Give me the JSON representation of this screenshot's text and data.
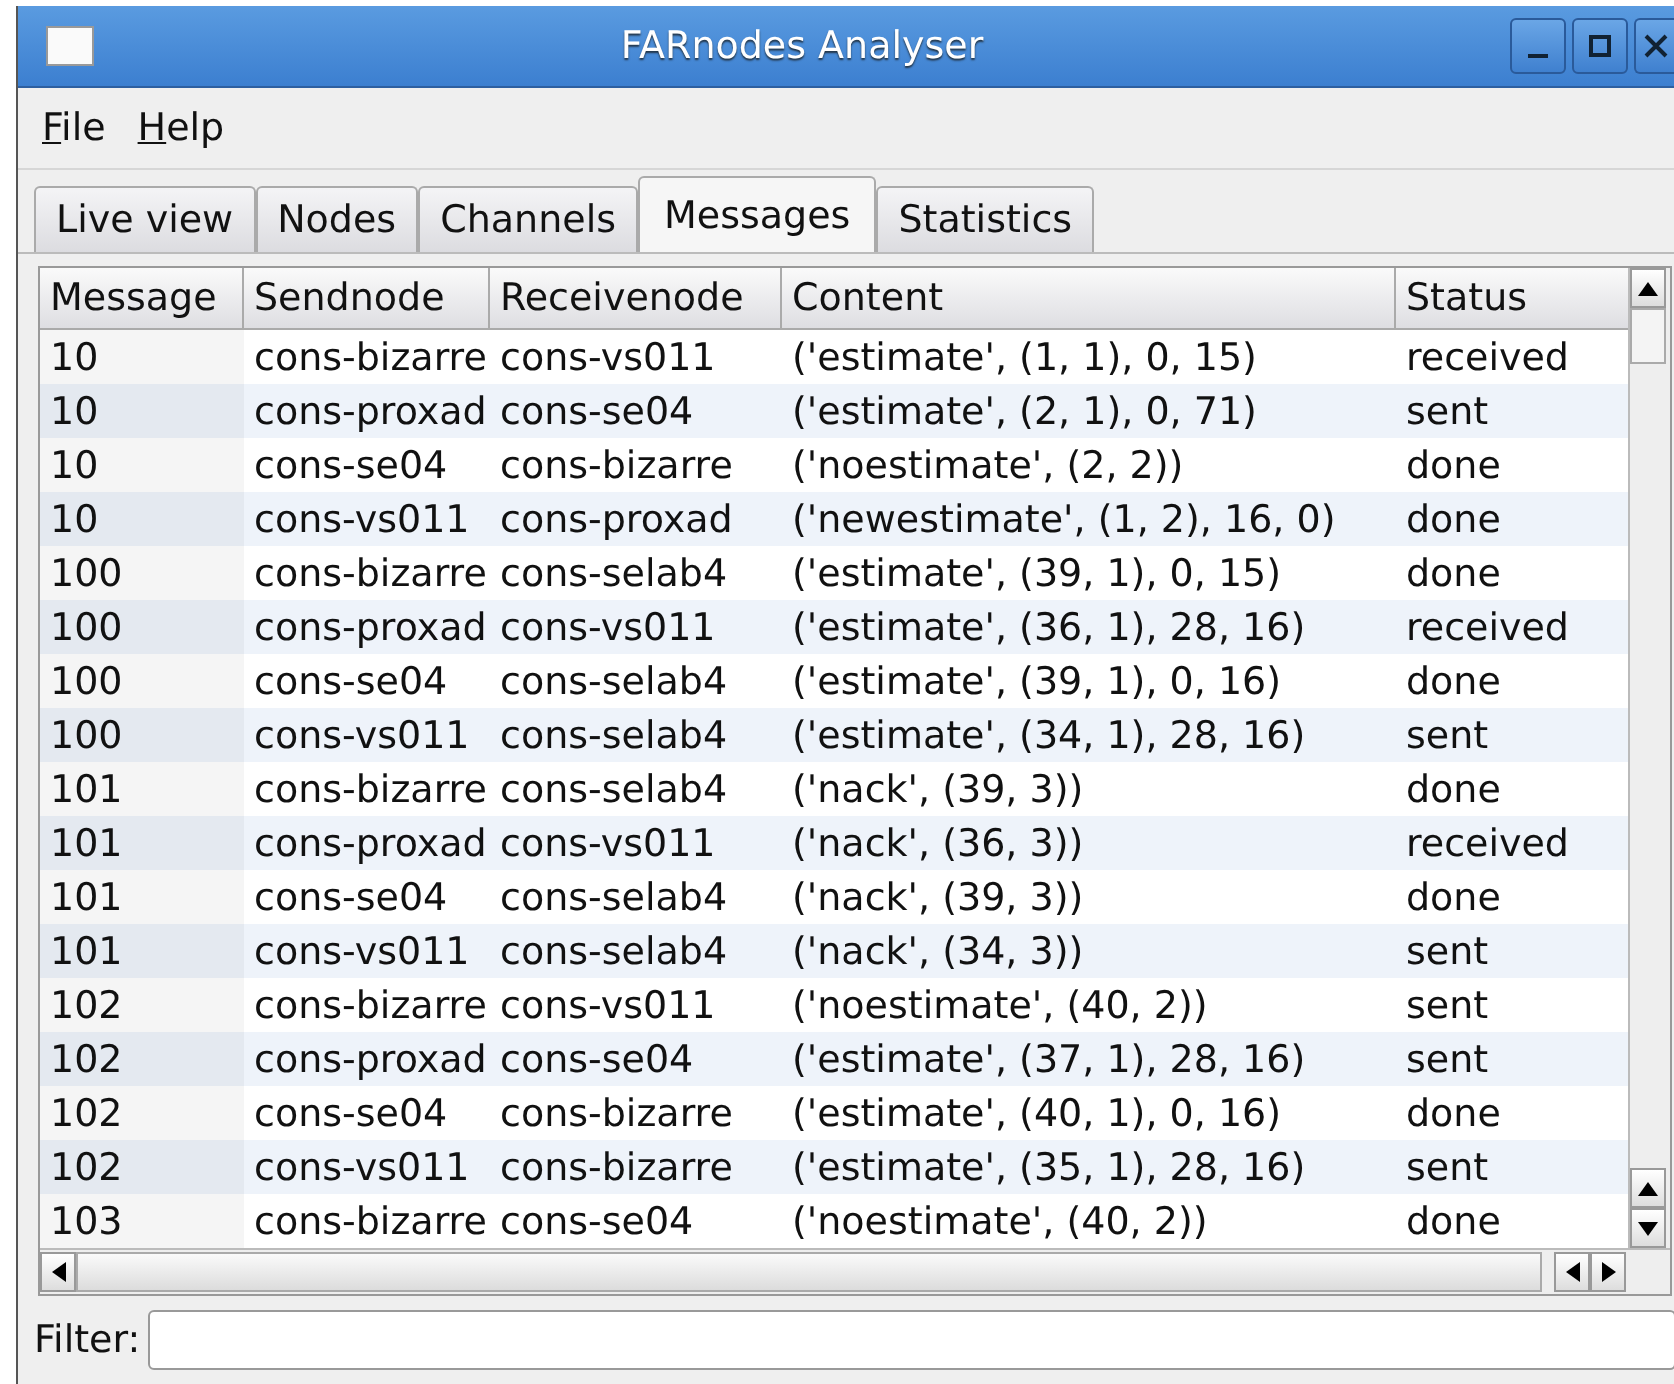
{
  "window": {
    "title": "FARnodes Analyser"
  },
  "menu": [
    "File",
    "Help"
  ],
  "tabs": [
    {
      "label": "Live view",
      "selected": false
    },
    {
      "label": "Nodes",
      "selected": false
    },
    {
      "label": "Channels",
      "selected": false
    },
    {
      "label": "Messages",
      "selected": true
    },
    {
      "label": "Statistics",
      "selected": false
    }
  ],
  "table": {
    "columns": [
      "Message",
      "Sendnode",
      "Receivenode",
      "Content",
      "Status"
    ],
    "rows": [
      [
        "10",
        "cons-bizarre",
        "cons-vs011",
        "('estimate', (1, 1), 0, 15)",
        "received"
      ],
      [
        "10",
        "cons-proxad",
        "cons-se04",
        "('estimate', (2, 1), 0, 71)",
        "sent"
      ],
      [
        "10",
        "cons-se04",
        "cons-bizarre",
        "('noestimate', (2, 2))",
        "done"
      ],
      [
        "10",
        "cons-vs011",
        "cons-proxad",
        "('newestimate', (1, 2), 16, 0)",
        "done"
      ],
      [
        "100",
        "cons-bizarre",
        "cons-selab4",
        "('estimate', (39, 1), 0, 15)",
        "done"
      ],
      [
        "100",
        "cons-proxad",
        "cons-vs011",
        "('estimate', (36, 1), 28, 16)",
        "received"
      ],
      [
        "100",
        "cons-se04",
        "cons-selab4",
        "('estimate', (39, 1), 0, 16)",
        "done"
      ],
      [
        "100",
        "cons-vs011",
        "cons-selab4",
        "('estimate', (34, 1), 28, 16)",
        "sent"
      ],
      [
        "101",
        "cons-bizarre",
        "cons-selab4",
        "('nack', (39, 3))",
        "done"
      ],
      [
        "101",
        "cons-proxad",
        "cons-vs011",
        "('nack', (36, 3))",
        "received"
      ],
      [
        "101",
        "cons-se04",
        "cons-selab4",
        "('nack', (39, 3))",
        "done"
      ],
      [
        "101",
        "cons-vs011",
        "cons-selab4",
        "('nack', (34, 3))",
        "sent"
      ],
      [
        "102",
        "cons-bizarre",
        "cons-vs011",
        "('noestimate', (40, 2))",
        "sent"
      ],
      [
        "102",
        "cons-proxad",
        "cons-se04",
        "('estimate', (37, 1), 28, 16)",
        "sent"
      ],
      [
        "102",
        "cons-se04",
        "cons-bizarre",
        "('estimate', (40, 1), 0, 16)",
        "done"
      ],
      [
        "102",
        "cons-vs011",
        "cons-bizarre",
        "('estimate', (35, 1), 28, 16)",
        "sent"
      ],
      [
        "103",
        "cons-bizarre",
        "cons-se04",
        "('noestimate', (40, 2))",
        "done"
      ]
    ]
  },
  "filter": {
    "label": "Filter:"
  }
}
